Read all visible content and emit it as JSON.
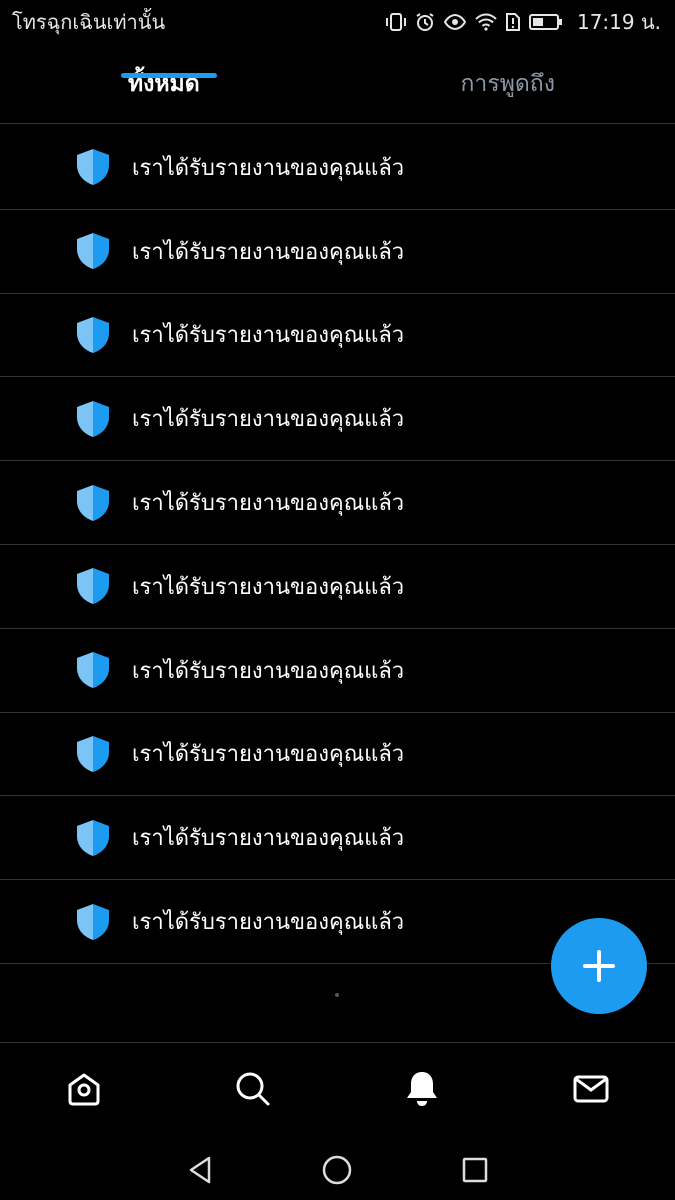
{
  "status_bar": {
    "carrier": "โทรฉุกเฉินเท่านั้น",
    "time": "17:19 น."
  },
  "tabs": [
    {
      "label": "ทั้งหมด",
      "active": true
    },
    {
      "label": "การพูดถึง",
      "active": false
    }
  ],
  "notifications": [
    {
      "icon": "shield-icon",
      "text": "เราได้รับรายงานของคุณแล้ว"
    },
    {
      "icon": "shield-icon",
      "text": "เราได้รับรายงานของคุณแล้ว"
    },
    {
      "icon": "shield-icon",
      "text": "เราได้รับรายงานของคุณแล้ว"
    },
    {
      "icon": "shield-icon",
      "text": "เราได้รับรายงานของคุณแล้ว"
    },
    {
      "icon": "shield-icon",
      "text": "เราได้รับรายงานของคุณแล้ว"
    },
    {
      "icon": "shield-icon",
      "text": "เราได้รับรายงานของคุณแล้ว"
    },
    {
      "icon": "shield-icon",
      "text": "เราได้รับรายงานของคุณแล้ว"
    },
    {
      "icon": "shield-icon",
      "text": "เราได้รับรายงานของคุณแล้ว"
    },
    {
      "icon": "shield-icon",
      "text": "เราได้รับรายงานของคุณแล้ว"
    },
    {
      "icon": "shield-icon",
      "text": "เราได้รับรายงานของคุณแล้ว"
    }
  ],
  "bottom_nav": [
    "home-icon",
    "search-icon",
    "notifications-bell-icon",
    "messages-mail-icon"
  ],
  "colors": {
    "accent": "#1d9bf0",
    "shield_light": "#7cc4f5",
    "shield_dark": "#1d9bf0",
    "divider": "#2f3336"
  }
}
